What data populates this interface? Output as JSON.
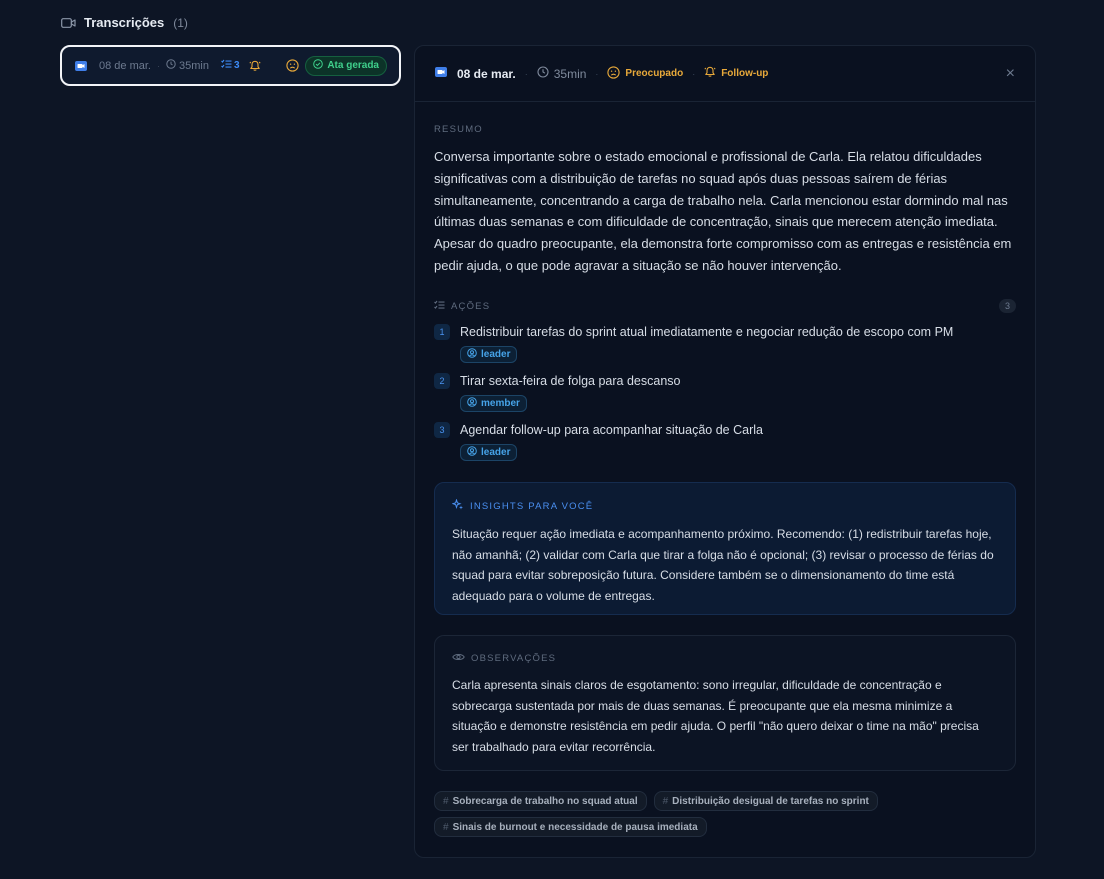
{
  "header": {
    "title": "Transcrições",
    "count": "(1)"
  },
  "list_item": {
    "date": "08 de mar.",
    "duration": "35min",
    "actions_count": "3",
    "status_badge": "Ata gerada"
  },
  "detail": {
    "date": "08 de mar.",
    "duration": "35min",
    "mood": "Preocupado",
    "followup": "Follow-up",
    "close": "×",
    "resumo_label": "RESUMO",
    "resumo_text": "Conversa importante sobre o estado emocional e profissional de Carla. Ela relatou dificuldades significativas com a distribuição de tarefas no squad após duas pessoas saírem de férias simultaneamente, concentrando a carga de trabalho nela. Carla mencionou estar dormindo mal nas últimas duas semanas e com dificuldade de concentração, sinais que merecem atenção imediata. Apesar do quadro preocupante, ela demonstra forte compromisso com as entregas e resistência em pedir ajuda, o que pode agravar a situação se não houver intervenção.",
    "acoes_label": "AÇÕES",
    "acoes_count": "3",
    "actions": [
      {
        "num": "1",
        "text": "Redistribuir tarefas do sprint atual imediatamente e negociar redução de escopo com PM",
        "role": "leader"
      },
      {
        "num": "2",
        "text": "Tirar sexta-feira de folga para descanso",
        "role": "member"
      },
      {
        "num": "3",
        "text": "Agendar follow-up para acompanhar situação de Carla",
        "role": "leader"
      }
    ],
    "insights_label": "INSIGHTS PARA VOCÊ",
    "insights_text": "Situação requer ação imediata e acompanhamento próximo. Recomendo: (1) redistribuir tarefas hoje, não amanhã; (2) validar com Carla que tirar a folga não é opcional; (3) revisar o processo de férias do squad para evitar sobreposição futura. Considere também se o dimensionamento do time está adequado para o volume de entregas.",
    "obs_label": "OBSERVAÇÕES",
    "obs_text": "Carla apresenta sinais claros de esgotamento: sono irregular, dificuldade de concentração e sobrecarga sustentada por mais de duas semanas. É preocupante que ela mesma minimize a situação e demonstre resistência em pedir ajuda. O perfil \"não quero deixar o time na mão\" precisa ser trabalhado para evitar recorrência.",
    "tags": [
      "Sobrecarga de trabalho no squad atual",
      "Distribuição desigual de tarefas no sprint",
      "Sinais de burnout e necessidade de pausa imediata"
    ]
  },
  "colors": {
    "background": "#0d1525",
    "accent_blue": "#3d8bf5",
    "warning": "#e8a93a",
    "success": "#3fd08c"
  },
  "icons": {
    "header": "video-camera-icon",
    "source": "google-meet-icon",
    "duration": "clock-icon",
    "actions": "checklist-icon",
    "followup": "bell-icon",
    "mood": "worried-face-icon",
    "ata": "check-circle-icon",
    "close": "close-icon",
    "role": "user-circle-icon",
    "insights": "sparkles-icon",
    "observations": "eye-icon",
    "tag": "hash-icon"
  }
}
